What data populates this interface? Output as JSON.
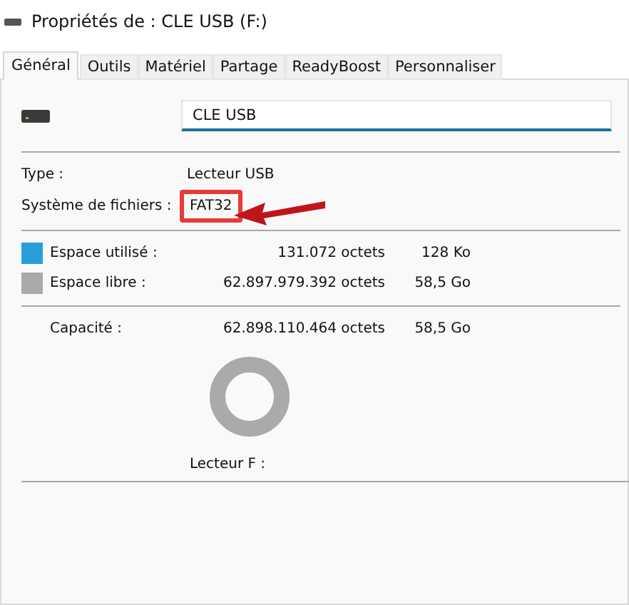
{
  "window": {
    "title": "Propriétés de : CLE USB (F:)"
  },
  "tabs": [
    {
      "label": "Général",
      "selected": true
    },
    {
      "label": "Outils",
      "selected": false
    },
    {
      "label": "Matériel",
      "selected": false
    },
    {
      "label": "Partage",
      "selected": false
    },
    {
      "label": "ReadyBoost",
      "selected": false
    },
    {
      "label": "Personnaliser",
      "selected": false
    }
  ],
  "name_field": {
    "value": "CLE USB"
  },
  "info": [
    {
      "label": "Type :",
      "value": "Lecteur USB",
      "highlighted": false
    },
    {
      "label": "Système de fichiers :",
      "value": "FAT32",
      "highlighted": true
    }
  ],
  "space": [
    {
      "label": "Espace utilisé :",
      "bytes": "131.072 octets",
      "size": "128 Ko",
      "color": "#27a0da"
    },
    {
      "label": "Espace libre :",
      "bytes": "62.897.979.392 octets",
      "size": "58,5 Go",
      "color": "#aaaaaa"
    }
  ],
  "capacity": {
    "label": "Capacité :",
    "bytes": "62.898.110.464 octets",
    "size": "58,5 Go"
  },
  "drive_label": "Lecteur F :"
}
